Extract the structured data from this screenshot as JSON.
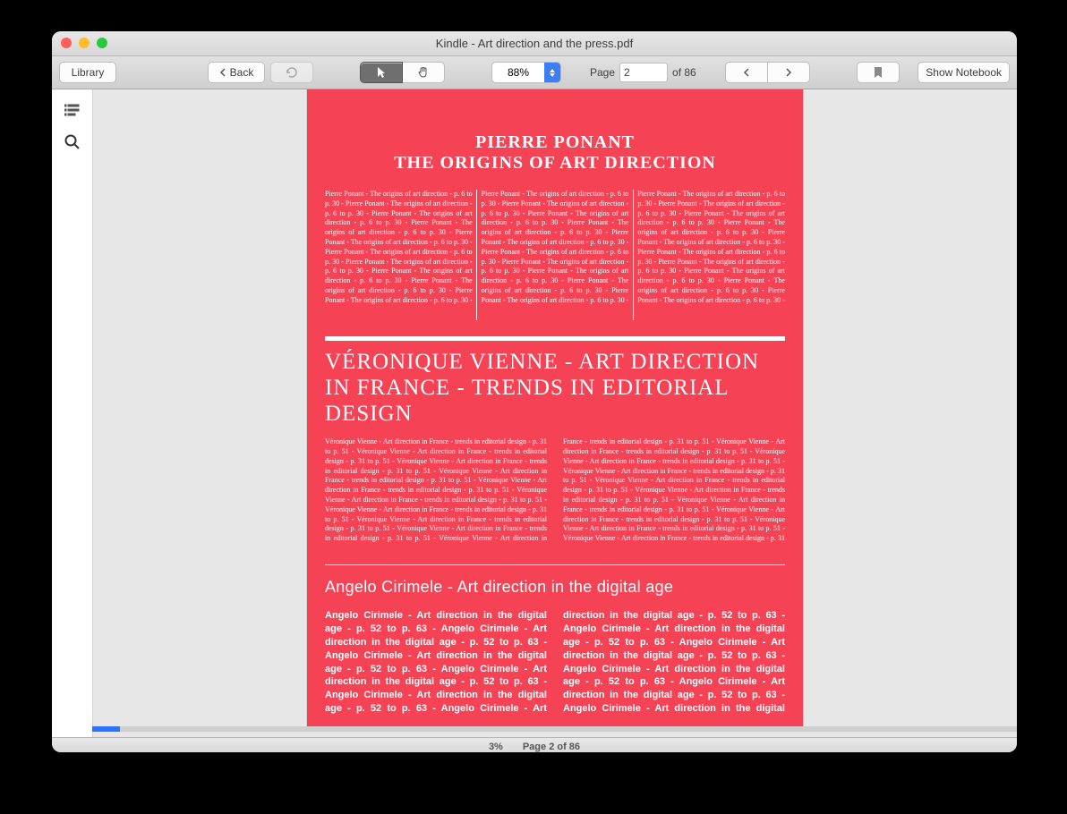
{
  "window": {
    "title": "Kindle - Art direction and the press.pdf"
  },
  "toolbar": {
    "library_label": "Library",
    "back_label": "Back",
    "zoom_value": "88%",
    "page_label": "Page",
    "page_value": "2",
    "page_total": "of 86",
    "show_notebook_label": "Show Notebook"
  },
  "status": {
    "percent": "3%",
    "page_text": "Page 2 of 86"
  },
  "doc": {
    "section1": {
      "author": "Pierre Ponant",
      "title": "The origins of art direction",
      "body_unit": "Pierre Ponant - The origins of art direction - p. 6 to p. 30 - "
    },
    "section2": {
      "title": "VÉRONIQUE VIENNE - ART DIRECTION IN FRANCE - TRENDS IN EDITORIAL DESIGN",
      "body_unit": "Véronique Vienne - Art direction in France - trends in editorial design - p. 31 to p. 51 - "
    },
    "section3": {
      "title": "Angelo Cirimele - Art direction in the digital age",
      "body_unit": "Angelo Cirimele - Art direction in the digital age - p. 52 to p. 63 - "
    }
  }
}
